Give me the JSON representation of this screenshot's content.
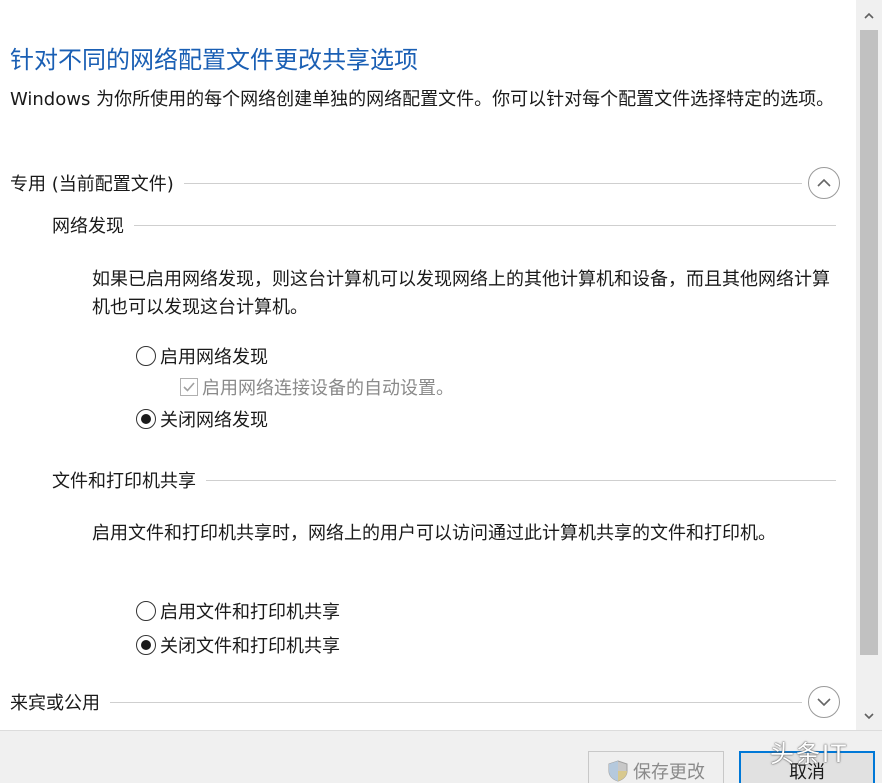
{
  "header": {
    "title": "针对不同的网络配置文件更改共享选项",
    "description": "Windows 为你所使用的每个网络创建单独的网络配置文件。你可以针对每个配置文件选择特定的选项。"
  },
  "private_profile": {
    "label": "专用 (当前配置文件)",
    "network_discovery": {
      "label": "网络发现",
      "description": "如果已启用网络发现，则这台计算机可以发现网络上的其他计算机和设备，而且其他网络计算机也可以发现这台计算机。",
      "option_on": "启用网络发现",
      "option_auto_setup": "启用网络连接设备的自动设置。",
      "option_off": "关闭网络发现",
      "selected": "off"
    },
    "file_printer_sharing": {
      "label": "文件和打印机共享",
      "description": "启用文件和打印机共享时，网络上的用户可以访问通过此计算机共享的文件和打印机。",
      "option_on": "启用文件和打印机共享",
      "option_off": "关闭文件和打印机共享",
      "selected": "off"
    }
  },
  "guest_profile": {
    "label": "来宾或公用"
  },
  "footer": {
    "save_label": "保存更改",
    "cancel_label": "取消"
  },
  "watermark": "头条IT",
  "colors": {
    "title": "#1a5fb4",
    "accent": "#0078d7"
  }
}
